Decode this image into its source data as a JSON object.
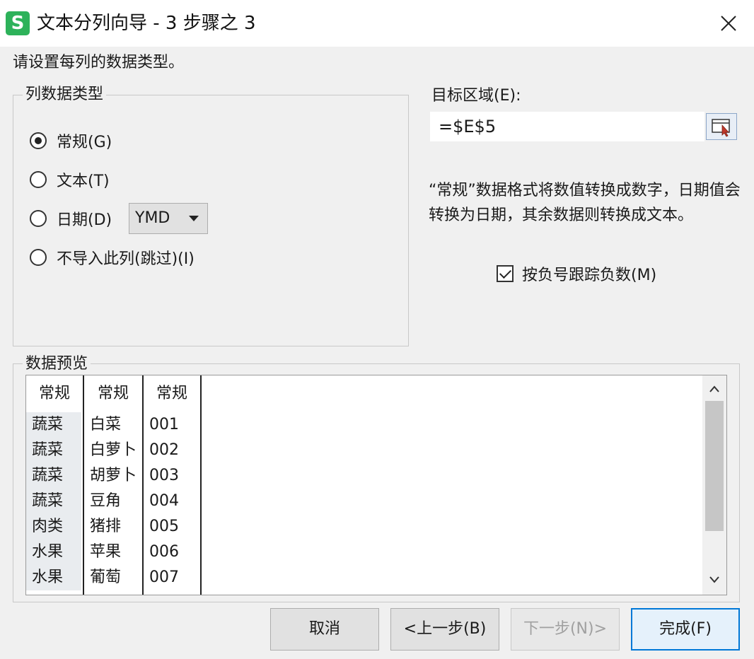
{
  "window": {
    "app_icon_letter": "S",
    "title": "文本分列向导 - 3 步骤之 3"
  },
  "instruction": "请设置每列的数据类型。",
  "column_type_group": {
    "title": "列数据类型",
    "options": [
      {
        "label": "常规(G)",
        "checked": true
      },
      {
        "label": "文本(T)",
        "checked": false
      },
      {
        "label": "日期(D)",
        "checked": false
      },
      {
        "label": "不导入此列(跳过)(I)",
        "checked": false
      }
    ],
    "date_format": "YMD"
  },
  "target": {
    "label": "目标区域(E):",
    "value": "=$E$5"
  },
  "description": "“常规”数据格式将数值转换成数字，日期值会转换为日期，其余数据则转换成文本。",
  "negative_checkbox": {
    "label": "按负号跟踪负数(M)",
    "checked": true
  },
  "preview": {
    "title": "数据预览",
    "headers": [
      "常规",
      "常规",
      "常规"
    ],
    "rows": [
      [
        "蔬菜",
        "白菜",
        "001"
      ],
      [
        "蔬菜",
        "白萝卜",
        "002"
      ],
      [
        "蔬菜",
        "胡萝卜",
        "003"
      ],
      [
        "蔬菜",
        "豆角",
        "004"
      ],
      [
        "肉类",
        "猪排",
        "005"
      ],
      [
        "水果",
        "苹果",
        "006"
      ],
      [
        "水果",
        "葡萄",
        "007"
      ]
    ]
  },
  "buttons": {
    "cancel": "取消",
    "back": "<上一步(B)",
    "next": "下一步(N)>",
    "finish": "完成(F)"
  },
  "colors": {
    "app_icon": "#2db25a",
    "primary_border": "#0078d7"
  }
}
